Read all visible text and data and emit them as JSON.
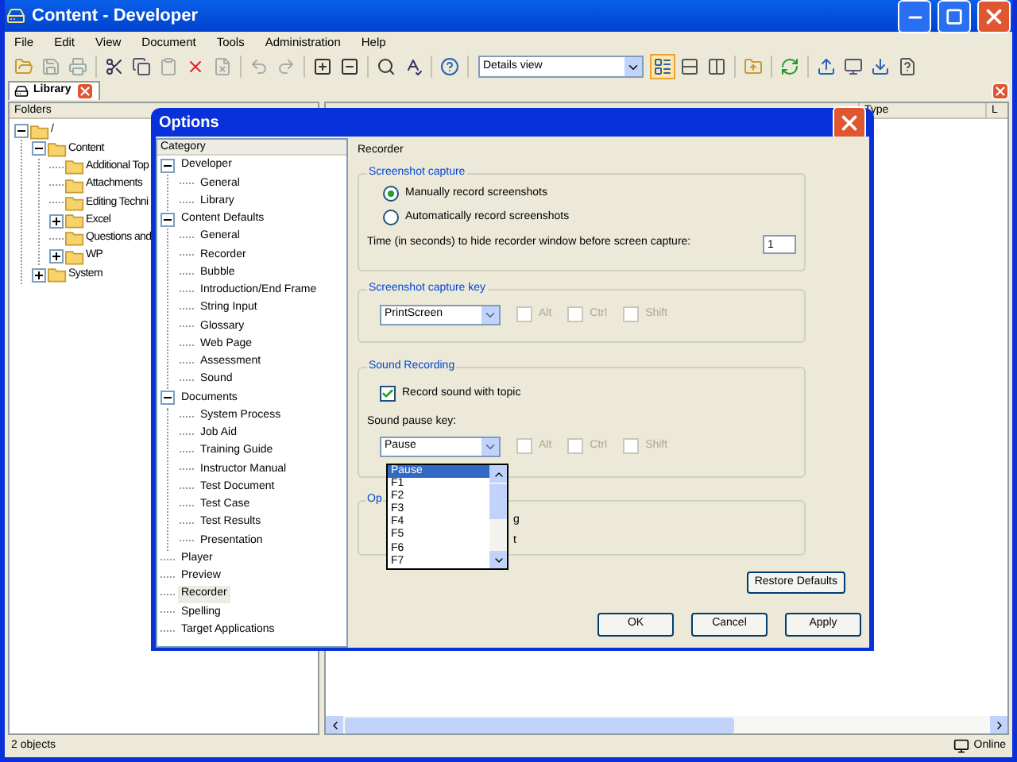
{
  "window": {
    "title": "Content - Developer"
  },
  "menu": [
    "File",
    "Edit",
    "View",
    "Document",
    "Tools",
    "Administration",
    "Help"
  ],
  "toolbar": {
    "view_select": "Details view"
  },
  "tabs": [
    {
      "label": "Library",
      "selected": true
    }
  ],
  "folders": {
    "title": "Folders",
    "tree": [
      {
        "label": "/",
        "expanded": true,
        "children": [
          {
            "label": "Content",
            "expanded": true,
            "children": [
              {
                "label": "Additional Top"
              },
              {
                "label": "Attachments"
              },
              {
                "label": "Editing Techni"
              },
              {
                "label": "Excel",
                "expanded": false
              },
              {
                "label": "Questions and"
              },
              {
                "label": "WP",
                "expanded": false
              }
            ]
          },
          {
            "label": "System",
            "expanded": false
          }
        ]
      }
    ]
  },
  "list": {
    "columns": [
      "Type",
      "L"
    ]
  },
  "status_bar": {
    "text": "2 objects",
    "connection": "Online"
  },
  "dialog": {
    "title": "Options",
    "category_header": "Category",
    "categories": [
      {
        "label": "Developer",
        "expanded": true,
        "selected": false,
        "children": [
          {
            "label": "General",
            "selected": false
          },
          {
            "label": "Library",
            "selected": false
          }
        ]
      },
      {
        "label": "Content Defaults",
        "expanded": true,
        "selected": false,
        "children": [
          {
            "label": "General",
            "selected": false
          },
          {
            "label": "Recorder",
            "selected": false
          },
          {
            "label": "Bubble",
            "selected": false
          },
          {
            "label": "Introduction/End Frame",
            "selected": false
          },
          {
            "label": "String Input",
            "selected": false
          },
          {
            "label": "Glossary",
            "selected": false
          },
          {
            "label": "Web Page",
            "selected": false
          },
          {
            "label": "Assessment",
            "selected": false
          },
          {
            "label": "Sound",
            "selected": false
          }
        ]
      },
      {
        "label": "Documents",
        "expanded": true,
        "selected": false,
        "children": [
          {
            "label": "System Process",
            "selected": false
          },
          {
            "label": "Job Aid",
            "selected": false
          },
          {
            "label": "Training Guide",
            "selected": false
          },
          {
            "label": "Instructor Manual",
            "selected": false
          },
          {
            "label": "Test Document",
            "selected": false
          },
          {
            "label": "Test Case",
            "selected": false
          },
          {
            "label": "Test Results",
            "selected": false
          },
          {
            "label": "Presentation",
            "selected": false
          }
        ]
      },
      {
        "label": "Player",
        "selected": false
      },
      {
        "label": "Preview",
        "selected": false
      },
      {
        "label": "Recorder",
        "selected": true
      },
      {
        "label": "Spelling",
        "selected": false
      },
      {
        "label": "Target Applications",
        "selected": false
      }
    ],
    "page_title": "Recorder",
    "screenshot_capture": {
      "legend": "Screenshot capture",
      "modes": [
        {
          "label": "Manually record screenshots",
          "selected": true
        },
        {
          "label": "Automatically record screenshots",
          "selected": false
        }
      ],
      "delay_label": "Time (in seconds) to hide recorder window before screen capture:",
      "delay_value": "1"
    },
    "capture_key": {
      "legend": "Screenshot capture key",
      "key": "PrintScreen",
      "modifiers": [
        {
          "label": "Alt",
          "checked": false,
          "disabled": true
        },
        {
          "label": "Ctrl",
          "checked": false,
          "disabled": true
        },
        {
          "label": "Shift",
          "checked": false,
          "disabled": true
        }
      ]
    },
    "sound_recording": {
      "legend": "Sound Recording",
      "record_label": "Record sound with topic",
      "record_checked": true,
      "pause_label": "Sound pause key:",
      "pause_key": "Pause",
      "modifiers": [
        {
          "label": "Alt",
          "checked": false,
          "disabled": true
        },
        {
          "label": "Ctrl",
          "checked": false,
          "disabled": true
        },
        {
          "label": "Shift",
          "checked": false,
          "disabled": true
        }
      ],
      "dropdown": [
        {
          "label": "Pause",
          "selected": true
        },
        {
          "label": "F1",
          "selected": false
        },
        {
          "label": "F2",
          "selected": false
        },
        {
          "label": "F3",
          "selected": false
        },
        {
          "label": "F4",
          "selected": false
        },
        {
          "label": "F5",
          "selected": false
        },
        {
          "label": "F6",
          "selected": false
        },
        {
          "label": "F7",
          "selected": false
        }
      ]
    },
    "options_group": {
      "legend": "Op",
      "items": [
        "g",
        "t"
      ]
    },
    "restore_button": "Restore Defaults",
    "buttons": [
      "OK",
      "Cancel",
      "Apply"
    ]
  }
}
